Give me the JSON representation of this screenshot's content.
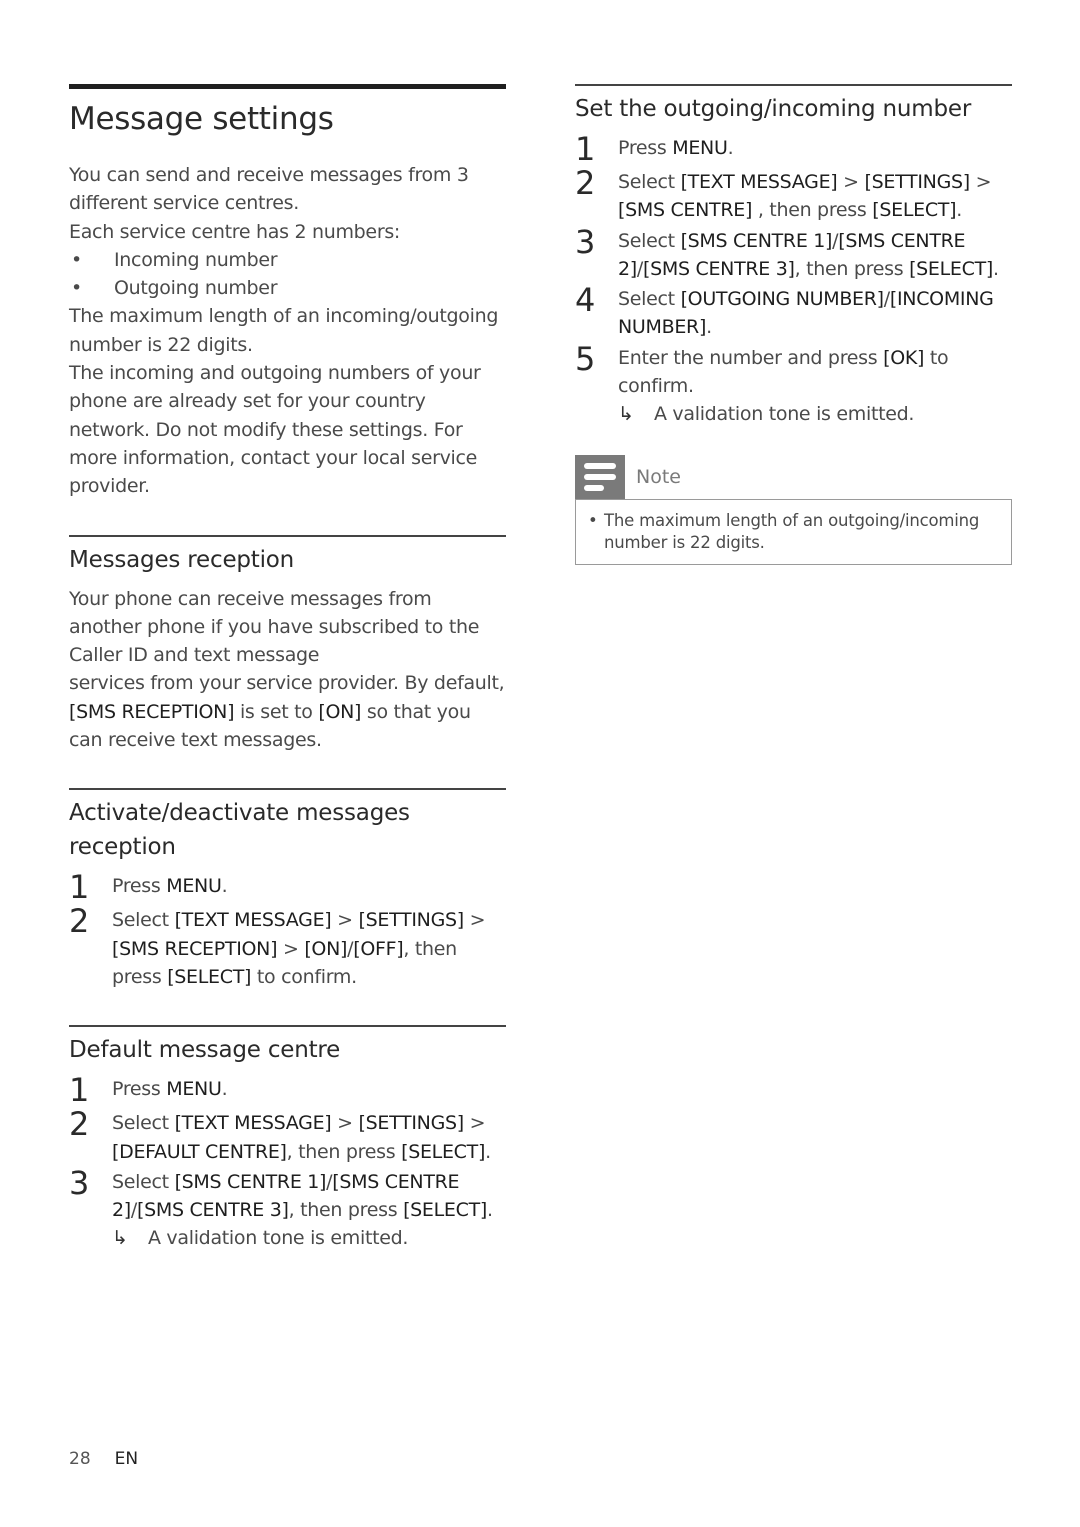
{
  "left": {
    "title": "Message settings",
    "intro": [
      "You can send and receive messages from 3 different service centres.",
      "Each service centre has 2 numbers:"
    ],
    "bullets": [
      "Incoming number",
      "Outgoing number"
    ],
    "intro_after": [
      "The maximum length of an incoming/outgoing number is 22 digits.",
      "The incoming and outgoing numbers of your phone are already set for your country network. Do not modify these settings. For more information, contact your local service provider."
    ],
    "reception": {
      "heading": "Messages reception",
      "para1": "Your phone can receive messages from another phone if you have subscribed to the Caller ID and text message",
      "para2": [
        {
          "t": "services from your service provider. By default, "
        },
        {
          "t": "[SMS RECEPTION]",
          "b": true
        },
        {
          "t": " is set to "
        },
        {
          "t": "[ON]",
          "b": true
        },
        {
          "t": " so that you can receive text messages."
        }
      ]
    },
    "activate": {
      "heading": "Activate/deactivate messages reception",
      "steps": [
        {
          "num": "1",
          "parts": [
            {
              "t": "Press "
            },
            {
              "t": "MENU",
              "b": true
            },
            {
              "t": "."
            }
          ]
        },
        {
          "num": "2",
          "parts": [
            {
              "t": "Select "
            },
            {
              "t": "[TEXT MESSAGE]",
              "b": true
            },
            {
              "t": " > "
            },
            {
              "t": "[SETTINGS]",
              "b": true
            },
            {
              "t": " > "
            },
            {
              "t": "[SMS RECEPTION]",
              "b": true
            },
            {
              "t": " > "
            },
            {
              "t": "[ON]",
              "b": true
            },
            {
              "t": "/"
            },
            {
              "t": "[OFF]",
              "b": true
            },
            {
              "t": ", then press "
            },
            {
              "t": "[SELECT]",
              "b": true
            },
            {
              "t": " to confirm."
            }
          ]
        }
      ]
    },
    "default_centre": {
      "heading": "Default message centre",
      "steps": [
        {
          "num": "1",
          "parts": [
            {
              "t": "Press "
            },
            {
              "t": "MENU",
              "b": true
            },
            {
              "t": "."
            }
          ]
        },
        {
          "num": "2",
          "parts": [
            {
              "t": "Select "
            },
            {
              "t": "[TEXT MESSAGE]",
              "b": true
            },
            {
              "t": " > "
            },
            {
              "t": "[SETTINGS]",
              "b": true
            },
            {
              "t": " > "
            },
            {
              "t": "[DEFAULT CENTRE]",
              "b": true
            },
            {
              "t": ", then press "
            },
            {
              "t": "[SELECT]",
              "b": true
            },
            {
              "t": "."
            }
          ]
        },
        {
          "num": "3",
          "parts": [
            {
              "t": "Select "
            },
            {
              "t": "[SMS CENTRE 1]",
              "b": true
            },
            {
              "t": "/"
            },
            {
              "t": "[SMS CENTRE 2]",
              "b": true
            },
            {
              "t": "/"
            },
            {
              "t": "[SMS CENTRE 3]",
              "b": true
            },
            {
              "t": ", then press "
            },
            {
              "t": "[SELECT]",
              "b": true
            },
            {
              "t": "."
            }
          ]
        }
      ],
      "result_arrow": "↳",
      "result": "A validation tone is emitted."
    }
  },
  "right": {
    "outgoing": {
      "heading": "Set the outgoing/incoming number",
      "steps": [
        {
          "num": "1",
          "parts": [
            {
              "t": "Press "
            },
            {
              "t": "MENU",
              "b": true
            },
            {
              "t": "."
            }
          ]
        },
        {
          "num": "2",
          "parts": [
            {
              "t": "Select "
            },
            {
              "t": "[TEXT MESSAGE]",
              "b": true
            },
            {
              "t": " > "
            },
            {
              "t": "[SETTINGS]",
              "b": true
            },
            {
              "t": " > "
            },
            {
              "t": "[SMS CENTRE]",
              "b": true
            },
            {
              "t": " , then press "
            },
            {
              "t": "[SELECT]",
              "b": true
            },
            {
              "t": "."
            }
          ]
        },
        {
          "num": "3",
          "parts": [
            {
              "t": "Select "
            },
            {
              "t": "[SMS CENTRE 1]",
              "b": true
            },
            {
              "t": "/"
            },
            {
              "t": "[SMS CENTRE 2]",
              "b": true
            },
            {
              "t": "/"
            },
            {
              "t": "[SMS CENTRE 3]",
              "b": true
            },
            {
              "t": ", then press "
            },
            {
              "t": "[SELECT]",
              "b": true
            },
            {
              "t": "."
            }
          ]
        },
        {
          "num": "4",
          "parts": [
            {
              "t": "Select "
            },
            {
              "t": "[OUTGOING NUMBER]",
              "b": true
            },
            {
              "t": "/"
            },
            {
              "t": "[INCOMING NUMBER]",
              "b": true
            },
            {
              "t": "."
            }
          ]
        },
        {
          "num": "5",
          "parts": [
            {
              "t": "Enter the number and press "
            },
            {
              "t": "[OK]",
              "b": true
            },
            {
              "t": " to confirm."
            }
          ]
        }
      ],
      "result_arrow": "↳",
      "result": "A validation tone is emitted."
    },
    "note": {
      "icon": "note-icon",
      "label": "Note",
      "bullet": "The maximum length of an outgoing/incoming number is 22 digits."
    }
  },
  "footer": {
    "page": "28",
    "lang": "EN"
  }
}
